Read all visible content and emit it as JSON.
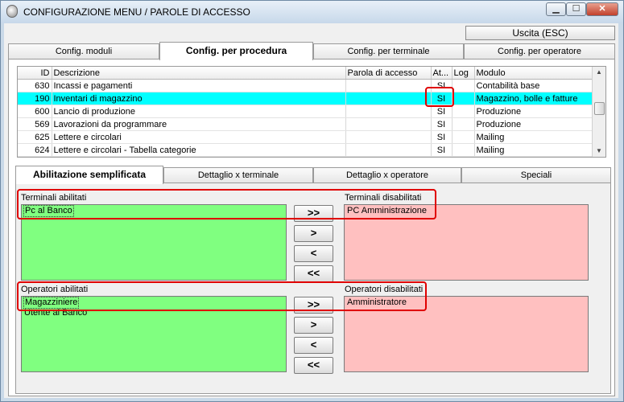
{
  "window": {
    "title": "CONFIGURAZIONE MENU / PAROLE DI ACCESSO"
  },
  "toolbar": {
    "exit_label": "Uscita (ESC)"
  },
  "main_tabs": [
    {
      "label": "Config. moduli"
    },
    {
      "label": "Config. per procedura"
    },
    {
      "label": "Config. per terminale"
    },
    {
      "label": "Config. per operatore"
    }
  ],
  "grid": {
    "columns": [
      "ID",
      "Descrizione",
      "Parola di accesso",
      "At...",
      "Log",
      "Modulo"
    ],
    "rows": [
      {
        "id": "630",
        "descrizione": "Incassi e pagamenti",
        "parola": "",
        "attivo": "SI",
        "log": "",
        "modulo": "Contabilità base"
      },
      {
        "id": "190",
        "descrizione": "Inventari di magazzino",
        "parola": "",
        "attivo": "SI",
        "log": "",
        "modulo": "Magazzino, bolle e fatture"
      },
      {
        "id": "600",
        "descrizione": "Lancio di produzione",
        "parola": "",
        "attivo": "SI",
        "log": "",
        "modulo": "Produzione"
      },
      {
        "id": "569",
        "descrizione": "Lavorazioni da programmare",
        "parola": "",
        "attivo": "SI",
        "log": "",
        "modulo": "Produzione"
      },
      {
        "id": "625",
        "descrizione": "Lettere e circolari",
        "parola": "",
        "attivo": "SI",
        "log": "",
        "modulo": "Mailing"
      },
      {
        "id": "624",
        "descrizione": "Lettere e circolari - Tabella categorie",
        "parola": "",
        "attivo": "SI",
        "log": "",
        "modulo": "Mailing"
      }
    ]
  },
  "sub_tabs": [
    {
      "label": "Abilitazione semplificata"
    },
    {
      "label": "Dettaglio x terminale"
    },
    {
      "label": "Dettaglio x operatore"
    },
    {
      "label": "Speciali"
    }
  ],
  "terminals": {
    "enabled_label": "Terminali abilitati",
    "disabled_label": "Terminali disabilitati",
    "enabled": [
      "Pc al Banco"
    ],
    "disabled": [
      "PC Amministrazione"
    ]
  },
  "operators": {
    "enabled_label": "Operatori abilitati",
    "disabled_label": "Operatori disabilitati",
    "enabled": [
      "Magazziniere",
      "Utente al Banco"
    ],
    "disabled": [
      "Amministratore"
    ]
  },
  "move_buttons": {
    "all_right": ">>",
    "right": ">",
    "left": "<",
    "all_left": "<<"
  },
  "colors": {
    "selected_row": "#00ffff",
    "enabled_list": "#80ff80",
    "disabled_list": "#ffc0c0",
    "highlight": "#e00000"
  },
  "icons": {
    "app": "settings-icon",
    "minimize": "minimize-icon",
    "maximize": "maximize-icon",
    "close": "close-icon"
  }
}
